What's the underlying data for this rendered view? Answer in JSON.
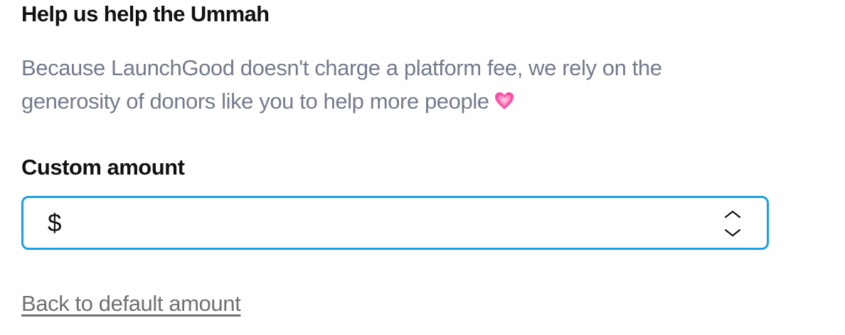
{
  "section": {
    "heading": "Help us help the Ummah",
    "description": "Because LaunchGood doesn't charge a platform fee, we rely on the generosity of donors like you to help more people",
    "description_icon": "growing-heart-icon"
  },
  "custom_amount": {
    "label": "Custom amount",
    "currency_symbol": "$",
    "value": "",
    "placeholder": "",
    "border_color": "#1a9fe0"
  },
  "actions": {
    "back_to_default": "Back to default amount"
  },
  "colors": {
    "heading": "#111111",
    "description": "#737a8b",
    "link": "#707070",
    "heart": "#ff4fa3"
  }
}
